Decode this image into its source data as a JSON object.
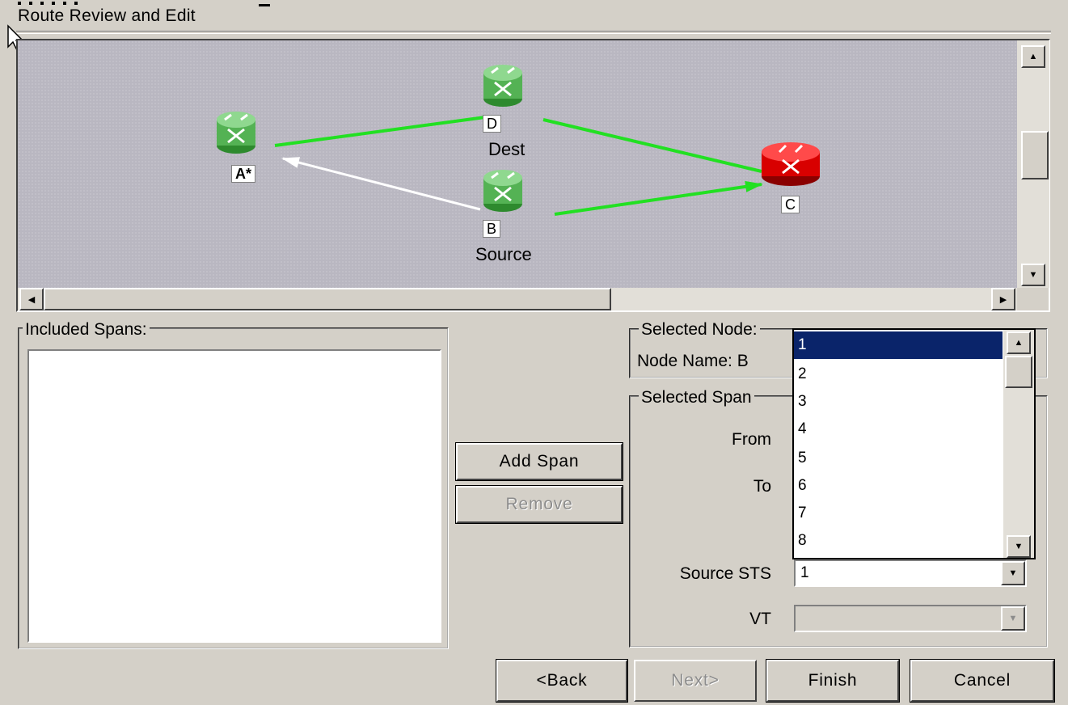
{
  "window": {
    "title": "Route Review and Edit"
  },
  "map": {
    "nodes": [
      {
        "id": "A",
        "label": "A*",
        "role": "",
        "color": "green"
      },
      {
        "id": "D",
        "label": "D",
        "role": "Dest",
        "color": "green"
      },
      {
        "id": "B",
        "label": "B",
        "role": "Source",
        "color": "green"
      },
      {
        "id": "C",
        "label": "C",
        "role": "",
        "color": "red"
      }
    ]
  },
  "included_spans": {
    "title": "Included Spans:"
  },
  "buttons": {
    "add_span": "Add Span",
    "remove": "Remove",
    "back": "<Back",
    "next": "Next>",
    "finish": "Finish",
    "cancel": "Cancel"
  },
  "selected_node": {
    "title": "Selected Node:",
    "node_name_label": "Node Name: B"
  },
  "selected_span": {
    "title": "Selected Span",
    "from_label": "From",
    "to_label": "To",
    "source_sts_label": "Source STS",
    "source_sts_value": "1",
    "vt_label": "VT",
    "vt_value": ""
  },
  "dropdown": {
    "options": [
      "1",
      "2",
      "3",
      "4",
      "5",
      "6",
      "7",
      "8"
    ],
    "selected": "1"
  },
  "colors": {
    "link_green": "#22e022",
    "link_white": "#ffffff",
    "node_green": "#5fbf5f",
    "node_red": "#e01010",
    "selection": "#0a246a",
    "canvas": "#b9b7c1"
  }
}
